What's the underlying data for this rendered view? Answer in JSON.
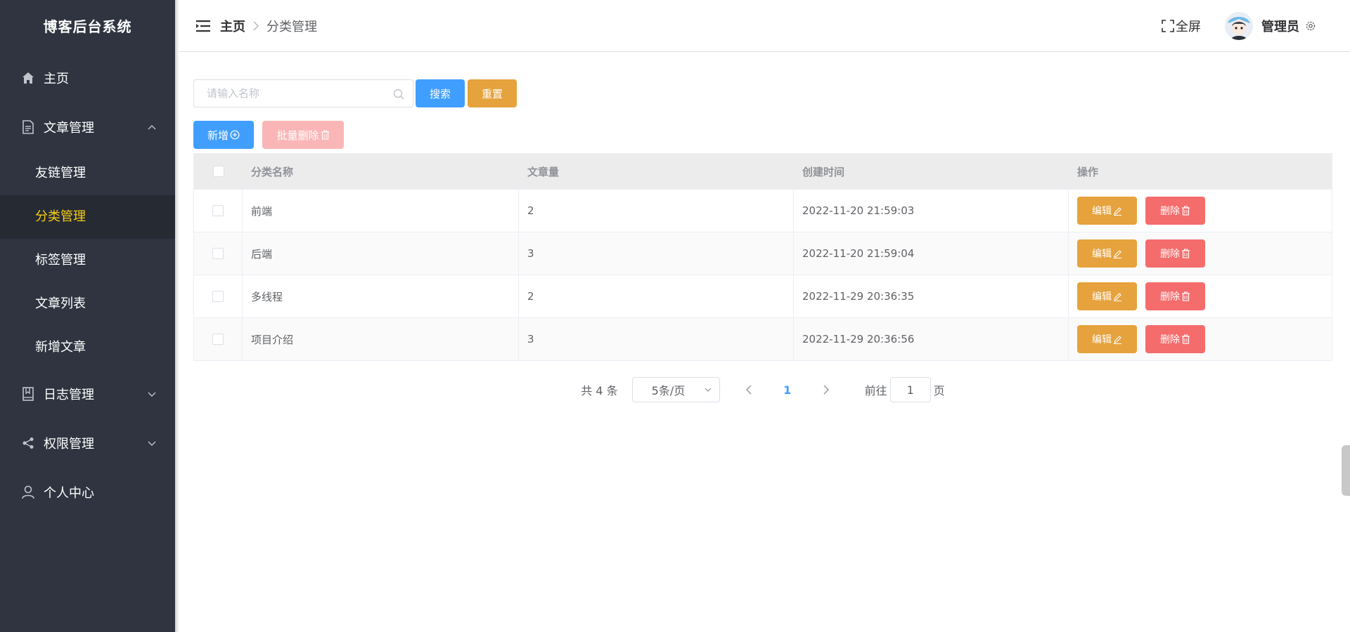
{
  "app": {
    "title": "博客后台系统"
  },
  "sidebar": {
    "items": [
      {
        "label": "主页",
        "icon": "home-icon"
      },
      {
        "label": "文章管理",
        "icon": "document-icon",
        "expanded": true,
        "children": [
          {
            "label": "友链管理"
          },
          {
            "label": "分类管理",
            "active": true
          },
          {
            "label": "标签管理"
          },
          {
            "label": "文章列表"
          },
          {
            "label": "新增文章"
          }
        ]
      },
      {
        "label": "日志管理",
        "icon": "book-icon"
      },
      {
        "label": "权限管理",
        "icon": "share-icon"
      },
      {
        "label": "个人中心",
        "icon": "user-icon"
      }
    ]
  },
  "header": {
    "breadcrumb": {
      "home": "主页",
      "current": "分类管理"
    },
    "fullscreen_label": "全屏",
    "username": "管理员"
  },
  "toolbar": {
    "search_placeholder": "请输入名称",
    "search_label": "搜索",
    "reset_label": "重置",
    "add_label": "新增",
    "batch_delete_label": "批量删除"
  },
  "table": {
    "columns": [
      "分类名称",
      "文章量",
      "创建时间",
      "操作"
    ],
    "rows": [
      {
        "name": "前端",
        "count": "2",
        "created": "2022-11-20 21:59:03"
      },
      {
        "name": "后端",
        "count": "3",
        "created": "2022-11-20 21:59:04"
      },
      {
        "name": "多线程",
        "count": "2",
        "created": "2022-11-29 20:36:35"
      },
      {
        "name": "项目介绍",
        "count": "3",
        "created": "2022-11-29 20:36:56"
      }
    ],
    "edit_label": "编辑",
    "delete_label": "删除"
  },
  "pagination": {
    "total": "共 4 条",
    "page_size": "5条/页",
    "current": "1",
    "goto_label": "前往",
    "goto_value": "1",
    "page_suffix": "页"
  },
  "colors": {
    "sidebar_bg": "#2f3440",
    "active_text": "#f7cd16",
    "primary": "#409eff",
    "warning": "#e6a23c",
    "danger": "#f56c6c"
  }
}
